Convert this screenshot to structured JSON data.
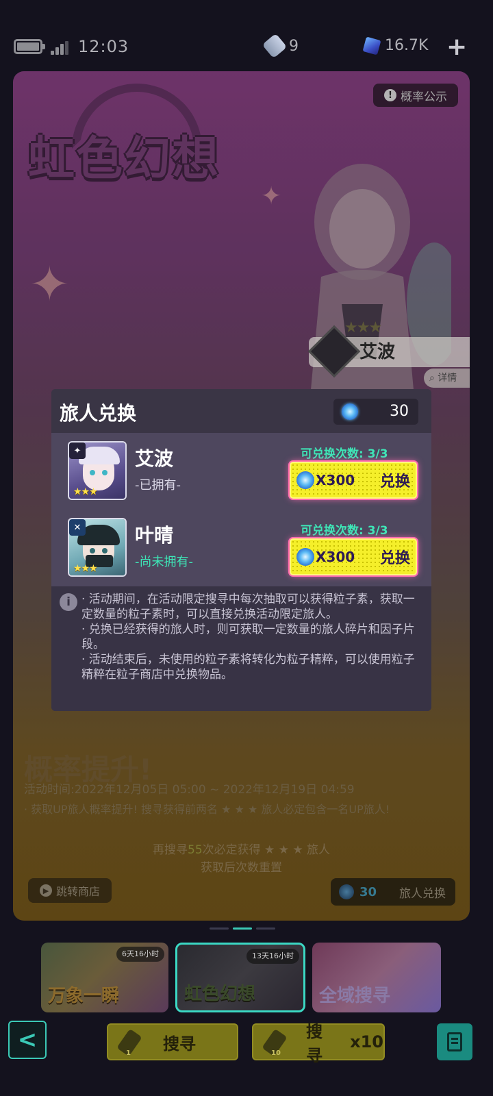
{
  "status_bar": {
    "time": "12:03",
    "tickets": "9",
    "gems": "16.7K",
    "add_icon": "plus-icon"
  },
  "banner": {
    "title": "虹色幻想",
    "probability_button": "概率公示",
    "featured_name": "艾波",
    "featured_stars": "★★★",
    "detail_label": "详情",
    "rate_up_title": "概率提升!",
    "time_range": "活动时间:2022年12月05日 05:00 ~ 2022年12月19日 04:59",
    "rate_up_desc": "· 获取UP旅人概率提升! 搜寻获得前两名 ★ ★ ★ 旅人必定包含一名UP旅人!",
    "pity_prefix": "再搜寻",
    "pity_count": "55",
    "pity_suffix": "次必定获得 ★ ★ ★ 旅人",
    "pity_line2": "获取后次数重置",
    "shop_jump": "跳转商店",
    "exchange_cost": "30",
    "exchange_label": "旅人兑换"
  },
  "modal": {
    "title": "旅人兑换",
    "particle_balance": "30",
    "rows": [
      {
        "name": "艾波",
        "status": "-已拥有-",
        "status_color": "#d9d6e6",
        "count": "可兑换次数: 3/3",
        "price": "X300",
        "button": "兑换",
        "stars": "★★★",
        "class_icon": "✦"
      },
      {
        "name": "叶晴",
        "status": "-尚未拥有-",
        "status_color": "#3ee6b7",
        "count": "可兑换次数: 3/3",
        "price": "X300",
        "button": "兑换",
        "stars": "★★★",
        "class_icon": "✕"
      }
    ],
    "info_icon": "i",
    "info": [
      "· 活动期间，在活动限定搜寻中每次抽取可以获得粒子素，获取一定数量的粒子素时，可以直接兑换活动限定旅人。",
      "· 兑换已经获得的旅人时，则可获取一定数量的旅人碎片和因子片段。",
      "· 活动结束后，未使用的粒子素将转化为粒子精粹，可以使用粒子精粹在粒子商店中兑换物品。"
    ]
  },
  "carousel": [
    {
      "title": "万象一瞬",
      "timer": "6天16小时"
    },
    {
      "title": "虹色幻想",
      "timer": "13天16小时"
    },
    {
      "title": "全域搜寻",
      "timer": ""
    }
  ],
  "toolbar": {
    "back_icon": "back-arrow-icon",
    "single_count": "1",
    "single_label": "搜寻",
    "multi_count": "10",
    "multi_label": "搜寻",
    "multi_mult": "x10",
    "menu_icon": "record-icon"
  },
  "colors": {
    "accent_teal": "#3bc9b6",
    "button_yellow": "#f5ef2a",
    "count_green": "#3ee6b7"
  }
}
